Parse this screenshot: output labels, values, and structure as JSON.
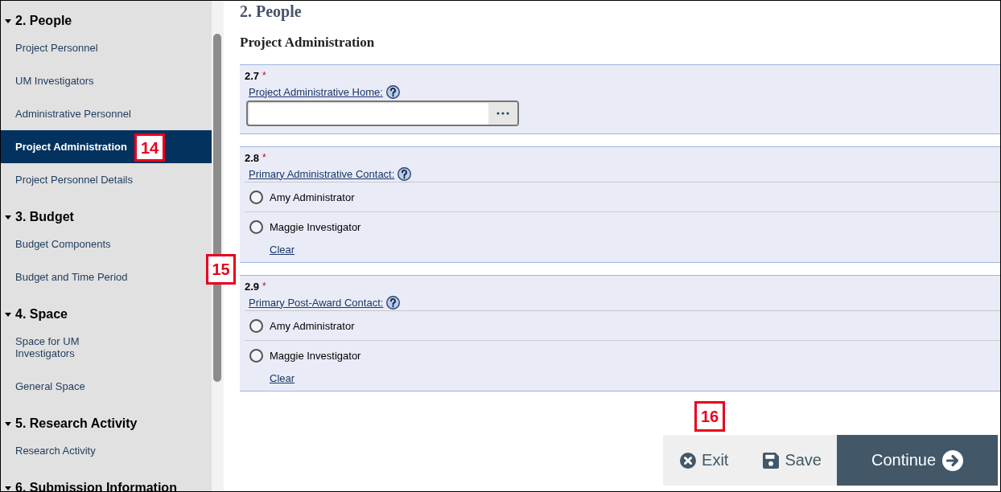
{
  "sidebar": {
    "sections": [
      {
        "title": "2. People",
        "expanded": true,
        "items": [
          {
            "label": "Project Personnel",
            "selected": false
          },
          {
            "label": "UM Investigators",
            "selected": false
          },
          {
            "label": "Administrative Personnel",
            "selected": false
          },
          {
            "label": "Project Administration",
            "selected": true
          },
          {
            "label": "Project Personnel Details",
            "selected": false
          }
        ]
      },
      {
        "title": "3. Budget",
        "expanded": true,
        "items": [
          {
            "label": "Budget Components",
            "selected": false
          },
          {
            "label": "Budget and Time Period",
            "selected": false
          }
        ]
      },
      {
        "title": "4. Space",
        "expanded": true,
        "items": [
          {
            "label": "Space for UM Investigators",
            "selected": false
          },
          {
            "label": "General Space",
            "selected": false
          }
        ]
      },
      {
        "title": "5. Research Activity",
        "expanded": true,
        "items": [
          {
            "label": "Research Activity",
            "selected": false
          }
        ]
      },
      {
        "title": "6. Submission Information",
        "expanded": true
      }
    ]
  },
  "page": {
    "title": "2. People",
    "subtitle": "Project Administration"
  },
  "questions": [
    {
      "kind": "lookup",
      "number": "2.7",
      "required_mark": "*",
      "label": "Project Administrative Home:"
    },
    {
      "kind": "radio",
      "number": "2.8",
      "required_mark": "*",
      "label": "Primary Administrative Contact:",
      "options": [
        {
          "label": "Amy Administrator",
          "selected": false
        },
        {
          "label": "Maggie Investigator",
          "selected": false
        }
      ],
      "clear_link": "Clear"
    },
    {
      "kind": "radio",
      "number": "2.9",
      "required_mark": "*",
      "label": "Primary Post-Award Contact:",
      "options": [
        {
          "label": "Amy Administrator",
          "selected": false
        },
        {
          "label": "Maggie Investigator",
          "selected": false
        }
      ],
      "clear_link": "Clear"
    }
  ],
  "footer": {
    "buttons": [
      {
        "kind": "exit",
        "label": "Exit"
      },
      {
        "kind": "save",
        "label": "Save"
      },
      {
        "kind": "continue",
        "label": "Continue"
      }
    ]
  },
  "callouts": [
    {
      "label": "14"
    },
    {
      "label": "15"
    },
    {
      "label": "16"
    }
  ]
}
